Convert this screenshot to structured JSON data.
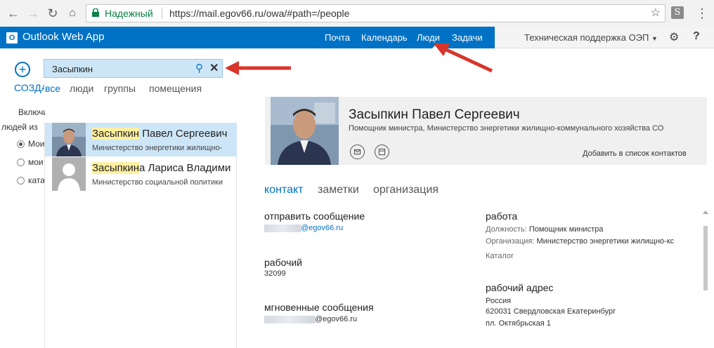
{
  "browser": {
    "secure_label": "Надежный",
    "url": "https://mail.egov66.ru/owa/#path=/people",
    "ext_letter": "S"
  },
  "header": {
    "app_title": "Outlook Web App",
    "nav": [
      "Почта",
      "Календарь",
      "Люди",
      "Задачи"
    ],
    "active_nav": "Люди",
    "user": "Техническая поддержка ОЭП",
    "accent": "#0072c6"
  },
  "left": {
    "new_label": "СОЗДАТЬ",
    "include_label": "Включить",
    "people_from": "людей из",
    "radios": [
      "Мои",
      "мои",
      "каталог"
    ]
  },
  "search": {
    "value": "Засыпкин"
  },
  "filters": [
    "все",
    "люди",
    "группы",
    "помещения"
  ],
  "results": [
    {
      "highlight": "Засыпкин",
      "rest": " Павел Сергеевич",
      "sub": "Министерство энергетики жилищно-",
      "selected": true
    },
    {
      "highlight": "Засыпкин",
      "rest": "а Лариса Владими",
      "sub": "Министерство социальной политики",
      "selected": false
    }
  ],
  "contact": {
    "name": "Засыпкин Павел Сергеевич",
    "title": "Помощник министра, Министерство энергетики жилищно-коммунального хозяйства СО",
    "add_to_contacts": "Добавить в список контактов",
    "tabs": [
      "контакт",
      "заметки",
      "организация"
    ],
    "send_message": "отправить сообщение",
    "email_suffix": "@egov66.ru",
    "work_phone_label": "рабочий",
    "work_phone": "32099",
    "im_label": "мгновенные сообщения",
    "im_suffix": "@egov66.ru",
    "work_label": "работа",
    "position_label": "Должность:",
    "position": "Помощник министра",
    "org_label": "Организация:",
    "org": "Министерство энергетики жилищно-кс",
    "catalog": "Каталог",
    "address_label": "рабочий адрес",
    "address_lines": [
      "Россия",
      "620031 Свердловская Екатеринбург",
      "пл. Октябрьская 1"
    ]
  }
}
